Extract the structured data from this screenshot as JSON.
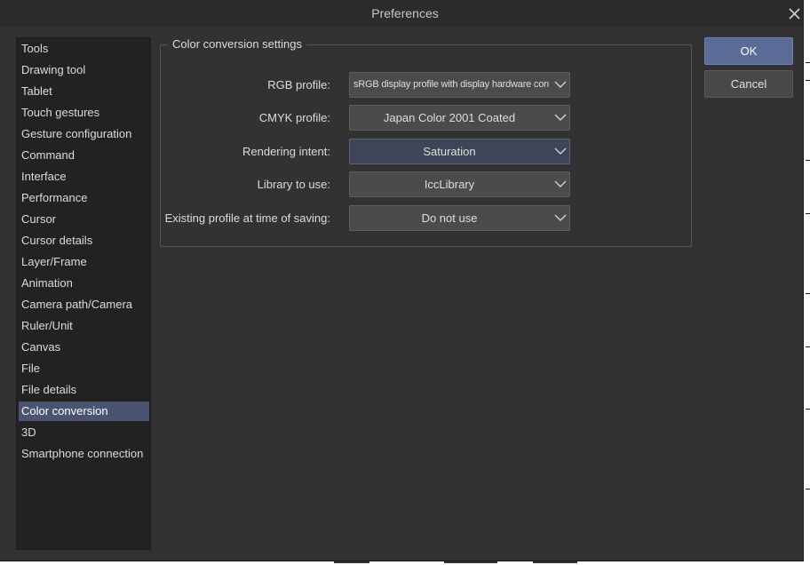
{
  "window": {
    "title": "Preferences"
  },
  "sidebar": {
    "items": [
      {
        "label": "Tools"
      },
      {
        "label": "Drawing tool"
      },
      {
        "label": "Tablet"
      },
      {
        "label": "Touch gestures"
      },
      {
        "label": "Gesture configuration"
      },
      {
        "label": "Command"
      },
      {
        "label": "Interface"
      },
      {
        "label": "Performance"
      },
      {
        "label": "Cursor"
      },
      {
        "label": "Cursor details"
      },
      {
        "label": "Layer/Frame"
      },
      {
        "label": "Animation"
      },
      {
        "label": "Camera path/Camera"
      },
      {
        "label": "Ruler/Unit"
      },
      {
        "label": "Canvas"
      },
      {
        "label": "File"
      },
      {
        "label": "File details"
      },
      {
        "label": "Color conversion"
      },
      {
        "label": "3D"
      },
      {
        "label": "Smartphone connection"
      }
    ],
    "selected": "Color conversion"
  },
  "settings": {
    "group_title": "Color conversion settings",
    "rows": [
      {
        "label": "RGB profile:",
        "value": "sRGB display profile with display hardware configu"
      },
      {
        "label": "CMYK profile:",
        "value": "Japan Color 2001 Coated"
      },
      {
        "label": "Rendering intent:",
        "value": "Saturation"
      },
      {
        "label": "Library to use:",
        "value": "IccLibrary"
      },
      {
        "label": "Existing profile at time of saving:",
        "value": "Do not use"
      }
    ]
  },
  "buttons": {
    "ok": "OK",
    "cancel": "Cancel"
  },
  "colors": {
    "dialog_bg": "#323232",
    "sidebar_bg": "#222222",
    "selection": "#4a5470",
    "ok_button": "#5a6b98"
  },
  "icons": {
    "close": "close-icon",
    "dropdown": "chevron-down-icon"
  }
}
